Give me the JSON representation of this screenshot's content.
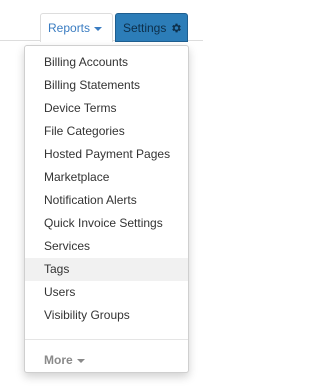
{
  "toolbar": {
    "reports_label": "Reports",
    "settings_label": "Settings"
  },
  "colors": {
    "link_blue": "#3a7cc1",
    "settings_bg": "#2c7db8",
    "hover_bg": "#f1f1f1"
  },
  "icons": {
    "reports_caret": "caret-down-icon",
    "settings_gear": "gear-icon",
    "more_caret": "caret-down-icon"
  },
  "menu": {
    "items": [
      {
        "label": "Billing Accounts"
      },
      {
        "label": "Billing Statements"
      },
      {
        "label": "Device Terms"
      },
      {
        "label": "File Categories"
      },
      {
        "label": "Hosted Payment Pages"
      },
      {
        "label": "Marketplace"
      },
      {
        "label": "Notification Alerts"
      },
      {
        "label": "Quick Invoice Settings"
      },
      {
        "label": "Services"
      },
      {
        "label": "Tags",
        "hovered": true
      },
      {
        "label": "Users"
      },
      {
        "label": "Visibility Groups"
      }
    ],
    "more_label": "More"
  }
}
